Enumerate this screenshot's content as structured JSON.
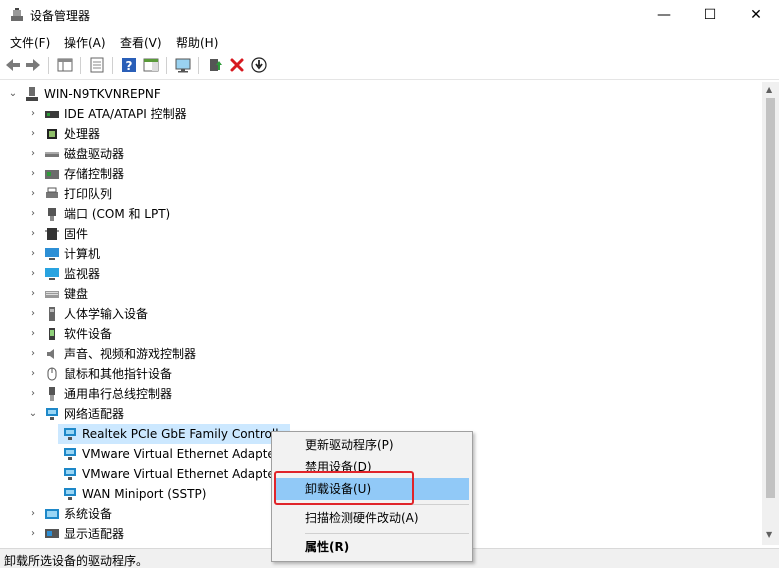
{
  "window": {
    "title": "设备管理器",
    "min_glyph": "—",
    "max_glyph": "☐",
    "close_glyph": "✕"
  },
  "menubar": {
    "items": [
      "文件(F)",
      "操作(A)",
      "查看(V)",
      "帮助(H)"
    ]
  },
  "toolbar": {
    "icons": [
      "back-arrow-icon",
      "forward-arrow-icon",
      "show-hide-tree-icon",
      "properties-icon",
      "help-icon",
      "action-pane-icon",
      "monitor-scan-icon",
      "update-driver-icon",
      "uninstall-x-icon",
      "disable-device-icon"
    ]
  },
  "tree": {
    "root": "WIN-N9TKVNREPNF",
    "categories": [
      {
        "label": "IDE ATA/ATAPI 控制器",
        "icon": "ide-controller-icon",
        "expanded": false
      },
      {
        "label": "处理器",
        "icon": "processor-icon",
        "expanded": false
      },
      {
        "label": "磁盘驱动器",
        "icon": "disk-drive-icon",
        "expanded": false
      },
      {
        "label": "存储控制器",
        "icon": "storage-controller-icon",
        "expanded": false
      },
      {
        "label": "打印队列",
        "icon": "printer-icon",
        "expanded": false
      },
      {
        "label": "端口 (COM 和 LPT)",
        "icon": "port-icon",
        "expanded": false
      },
      {
        "label": "固件",
        "icon": "firmware-icon",
        "expanded": false
      },
      {
        "label": "计算机",
        "icon": "computer-icon",
        "expanded": false
      },
      {
        "label": "监视器",
        "icon": "monitor-icon",
        "expanded": false
      },
      {
        "label": "键盘",
        "icon": "keyboard-icon",
        "expanded": false
      },
      {
        "label": "人体学输入设备",
        "icon": "hid-icon",
        "expanded": false
      },
      {
        "label": "软件设备",
        "icon": "software-device-icon",
        "expanded": false
      },
      {
        "label": "声音、视频和游戏控制器",
        "icon": "sound-icon",
        "expanded": false
      },
      {
        "label": "鼠标和其他指针设备",
        "icon": "mouse-icon",
        "expanded": false
      },
      {
        "label": "通用串行总线控制器",
        "icon": "usb-icon",
        "expanded": false
      },
      {
        "label": "网络适配器",
        "icon": "network-adapter-icon",
        "expanded": true
      }
    ],
    "network_children": [
      "Realtek PCIe GbE Family Controll",
      "VMware Virtual Ethernet Adapte",
      "VMware Virtual Ethernet Adapte",
      "WAN Miniport (SSTP)"
    ],
    "after_categories": [
      {
        "label": "系统设备",
        "icon": "system-device-icon"
      },
      {
        "label": "显示适配器",
        "icon": "display-adapter-icon"
      }
    ]
  },
  "context_menu": {
    "items": [
      "更新驱动程序(P)",
      "禁用设备(D)",
      "卸载设备(U)",
      "扫描检测硬件改动(A)",
      "属性(R)"
    ],
    "highlighted": "卸载设备(U)"
  },
  "statusbar": {
    "text": "卸载所选设备的驱动程序。"
  },
  "colors": {
    "selection": "#cce8ff",
    "menu_highlight": "#91c9f7",
    "annotation_red": "#e0242a",
    "network_icon": "#1e88c8"
  }
}
